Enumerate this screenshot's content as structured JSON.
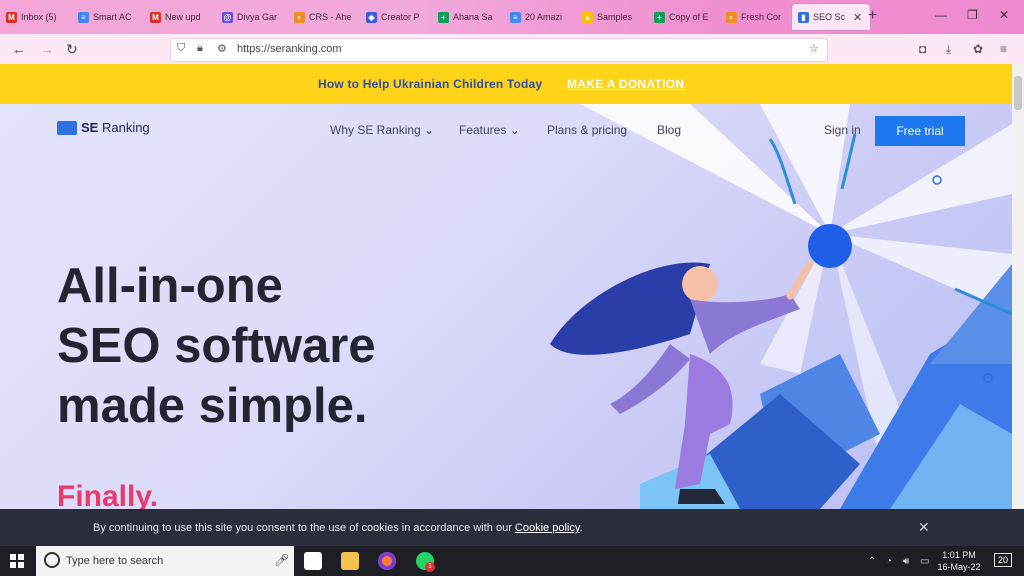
{
  "browser": {
    "tabs": [
      {
        "label": "Inbox (5)",
        "color": "#d93025",
        "glyph": "M"
      },
      {
        "label": "Smart AC",
        "color": "#4285f4",
        "glyph": "≡"
      },
      {
        "label": "New upd",
        "color": "#d93025",
        "glyph": "M"
      },
      {
        "label": "Divya Gar",
        "color": "#6b4ce6",
        "glyph": "@"
      },
      {
        "label": "CRS - Ahe",
        "color": "#f28b20",
        "glyph": "◐"
      },
      {
        "label": "Creator P",
        "color": "#3b5bdb",
        "glyph": "◆"
      },
      {
        "label": "Ahana Sa",
        "color": "#0f9d58",
        "glyph": "+"
      },
      {
        "label": "20 Amazi",
        "color": "#4285f4",
        "glyph": "≡"
      },
      {
        "label": "Samples",
        "color": "#fbbc04",
        "glyph": "▲"
      },
      {
        "label": "Copy of E",
        "color": "#0f9d58",
        "glyph": "+"
      },
      {
        "label": "Fresh Cor",
        "color": "#f28b20",
        "glyph": "◐"
      },
      {
        "label": "SEO Sc",
        "color": "#2f6fe0",
        "glyph": "▮",
        "active": true
      }
    ],
    "url": "https://seranking.com"
  },
  "banner": {
    "text": "How to Help Ukrainian Children Today",
    "link": "MAKE A DONATION"
  },
  "site": {
    "logo": {
      "prefix": "SE",
      "suffix": "Ranking"
    },
    "nav": [
      {
        "label": "Why SE Ranking",
        "dropdown": true
      },
      {
        "label": "Features",
        "dropdown": true
      },
      {
        "label": "Plans & pricing",
        "dropdown": false
      },
      {
        "label": "Blog",
        "dropdown": false
      }
    ],
    "signin": "Sign in",
    "cta": "Free trial",
    "hero_lines": [
      "All-in-one",
      "SEO software",
      "made simple."
    ],
    "finally": "Finally."
  },
  "cookie": {
    "text": "By continuing to use this site you consent to the use of cookies in accordance with our",
    "link": "Cookie policy",
    "suffix": "."
  },
  "taskbar": {
    "search_placeholder": "Type here to search",
    "time": "1:01 PM",
    "date": "16-May-22",
    "notifications": "20",
    "whatsapp_badge": "1"
  },
  "colors": {
    "brand_blue": "#1d77ee",
    "banner_yellow": "#ffd319",
    "accent_pink": "#e83a6b"
  }
}
